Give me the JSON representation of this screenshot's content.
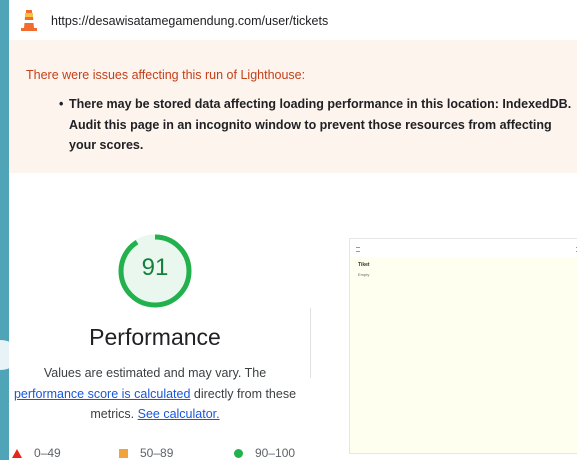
{
  "address_bar": {
    "url": "https://desawisatamegamendung.com/user/tickets"
  },
  "warning": {
    "title": "There were issues affecting this run of Lighthouse:",
    "items": [
      {
        "line1": "There may be stored data affecting loading performance in this location: IndexedDB.",
        "line2": "Audit this page in an incognito window to prevent those resources from affecting",
        "line3": "your scores."
      }
    ]
  },
  "performance": {
    "score": "91",
    "score_fraction": 0.91,
    "title": "Performance",
    "desc_line1": "Values are estimated and may vary. The",
    "link_calc": "performance score is calculated",
    "desc_line2_rest": " directly from these",
    "desc_line3_pre": "metrics. ",
    "link_see": "See calculator.",
    "colors": {
      "good": "#22b14c",
      "good_text": "#15803d",
      "average": "#f2a33a",
      "fail": "#e5281a"
    }
  },
  "legend": {
    "fail": "0–49",
    "average": "50–89",
    "pass": "90–100"
  },
  "screenshot_thumb": {
    "heading": "Tiket",
    "subtext": "Empty"
  }
}
